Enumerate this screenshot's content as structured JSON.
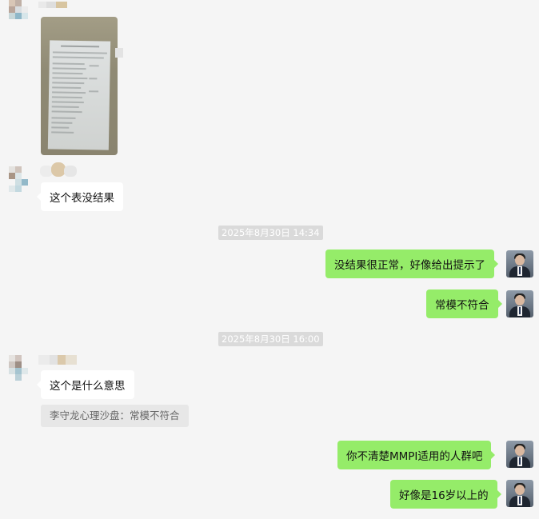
{
  "chat": {
    "messages": {
      "m1_text": "这个表没结果",
      "time1": "2025年8月30日 14:34",
      "r1_text": "没结果很正常，好像给出提示了",
      "r2_text": "常模不符合",
      "time2": "2025年8月30日 16:00",
      "m2_text": "这个是什么意思",
      "quote_text": "李守龙心理沙盘：常模不符合",
      "r3_text": "你不清楚MMPI适用的人群吧",
      "r4_text": "好像是16岁以上的"
    }
  },
  "colors": {
    "background": "#f5f5f5",
    "outgoing_bubble": "#95ec69",
    "incoming_bubble": "#ffffff",
    "timestamp_bg": "#dadada",
    "quote_bg": "#e7e7e7"
  }
}
